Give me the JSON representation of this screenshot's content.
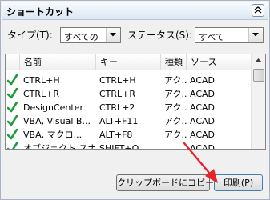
{
  "panel": {
    "title": "ショートカット"
  },
  "filters": {
    "type_label": "タイプ(T):",
    "type_value": "すべての",
    "status_label": "ステータス(S):",
    "status_value": "すべて"
  },
  "list": {
    "columns": [
      "名前",
      "キー",
      "種類",
      "ソース"
    ],
    "rows": [
      {
        "name": "CTRL+H",
        "key": "CTRL+H",
        "type": "アク...",
        "source": "ACAD"
      },
      {
        "name": "CTRL+R",
        "key": "CTRL+R",
        "type": "アク...",
        "source": "ACAD"
      },
      {
        "name": "DesignCenter",
        "key": "CTRL+2",
        "type": "アク...",
        "source": "ACAD"
      },
      {
        "name": "VBA, Visual B...",
        "key": "ALT+F11",
        "type": "アク...",
        "source": "ACAD"
      },
      {
        "name": "VBA, マクロ...",
        "key": "ALT+F8",
        "type": "アク...",
        "source": "ACAD"
      },
      {
        "name": "オブジェクト スナ...",
        "key": "SHIFT+Q",
        "type": "...",
        "source": "ACAD"
      }
    ]
  },
  "buttons": {
    "copy_label": "クリップボードにコピー",
    "print_label": "印刷(P)"
  },
  "colors": {
    "check": "#1e9b3c",
    "annotation_arrow": "#e8242a"
  }
}
